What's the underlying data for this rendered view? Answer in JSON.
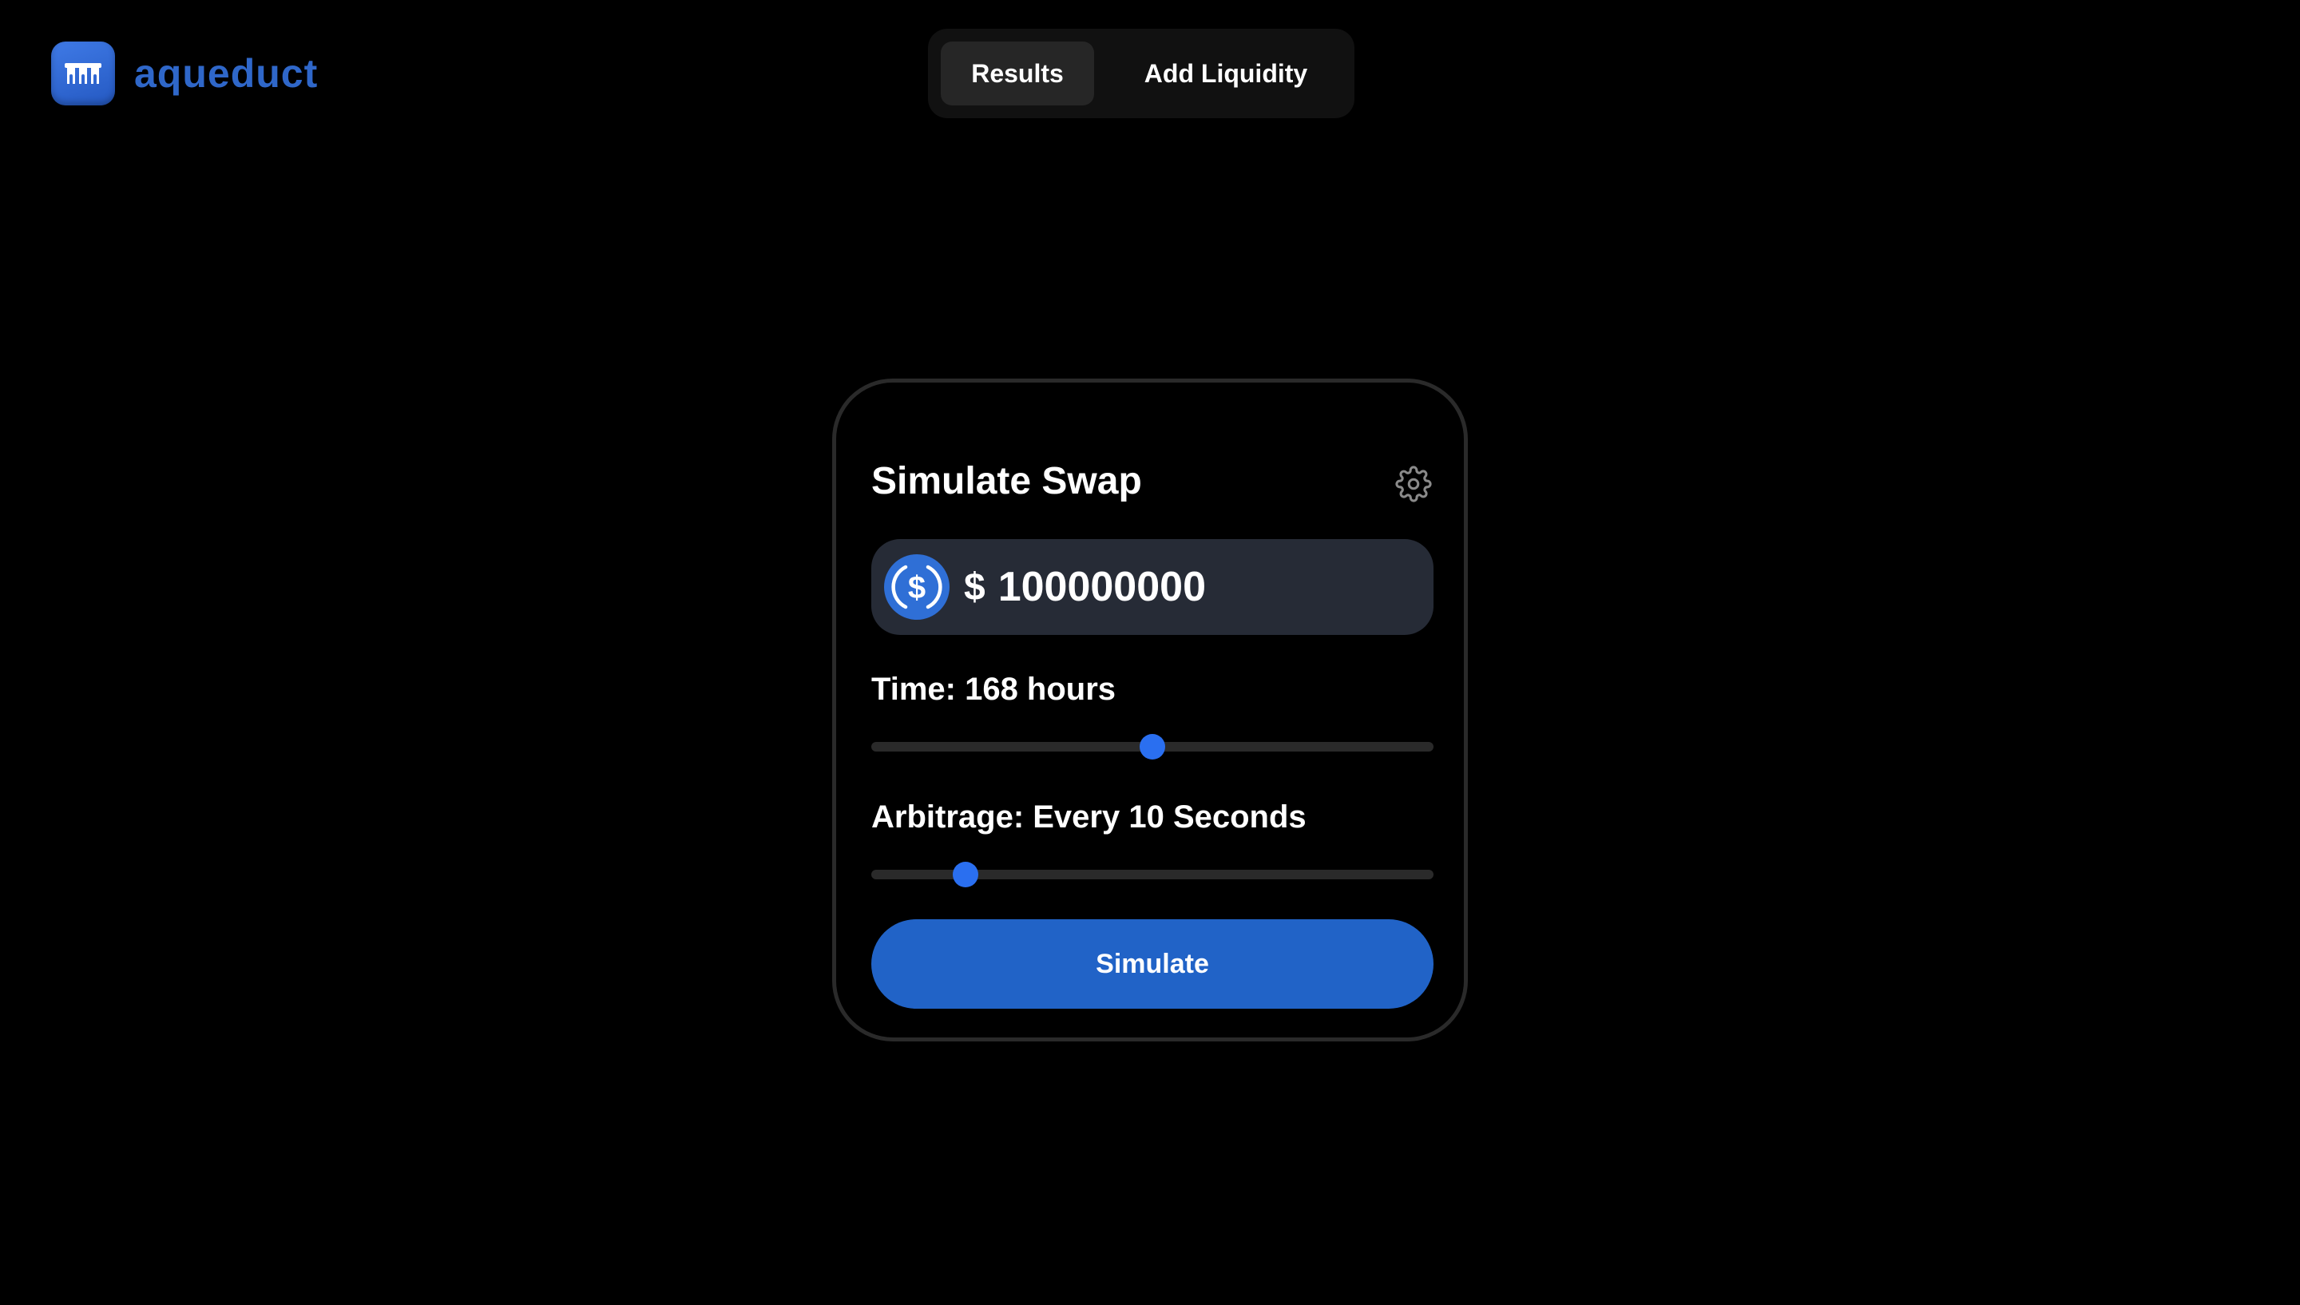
{
  "brand": {
    "name": "aqueduct",
    "logo_icon": "aqueduct-logo-icon",
    "color": "#2f67c9"
  },
  "nav": {
    "tabs": [
      {
        "label": "Results",
        "active": true
      },
      {
        "label": "Add Liquidity",
        "active": false
      }
    ]
  },
  "swap_card": {
    "title": "Simulate Swap",
    "settings_icon": "gear-icon",
    "token_icon": "usdc-icon",
    "currency_symbol": "$",
    "amount_value": "100000000",
    "time_label": "Time: 168 hours",
    "time_slider_fraction": 0.5,
    "arbitrage_label": "Arbitrage: Every 10 Seconds",
    "arbitrage_slider_fraction": 0.168,
    "simulate_label": "Simulate"
  },
  "colors": {
    "accent": "#2a6ff0",
    "button": "#2163c7",
    "input_bg": "#262b36",
    "background": "#000000"
  }
}
